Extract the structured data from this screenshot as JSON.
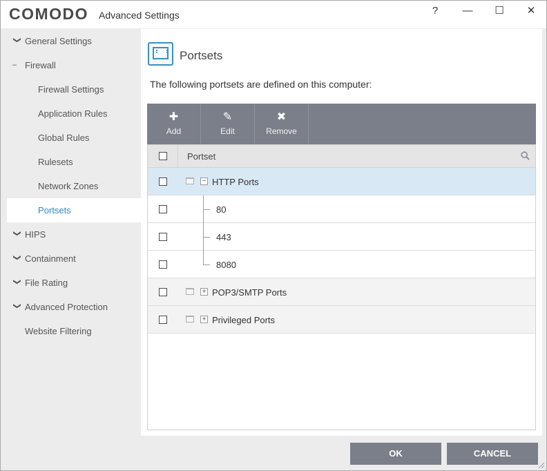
{
  "window": {
    "logo_text": "COMODO",
    "title": "Advanced Settings",
    "help_glyph": "?",
    "minimize_glyph": "—",
    "maximize_glyph": "☐",
    "close_glyph": "✕"
  },
  "sidebar": {
    "items": [
      {
        "label": "General Settings",
        "chevron": "❯"
      },
      {
        "label": "Firewall",
        "chevron": "–"
      },
      {
        "label": "Firewall Settings"
      },
      {
        "label": "Application Rules"
      },
      {
        "label": "Global Rules"
      },
      {
        "label": "Rulesets"
      },
      {
        "label": "Network Zones"
      },
      {
        "label": "Portsets"
      },
      {
        "label": "HIPS",
        "chevron": "❯"
      },
      {
        "label": "Containment",
        "chevron": "❯"
      },
      {
        "label": "File Rating",
        "chevron": "❯"
      },
      {
        "label": "Advanced Protection",
        "chevron": "❯"
      },
      {
        "label": "Website Filtering"
      }
    ]
  },
  "main": {
    "title": "Portsets",
    "description": "The following portsets are defined on this computer:"
  },
  "toolbar": {
    "add_icon": "✚",
    "add_label": "Add",
    "edit_icon": "✎",
    "edit_label": "Edit",
    "remove_icon": "✖",
    "remove_label": "Remove"
  },
  "table": {
    "column_header": "Portset",
    "rows": [
      {
        "label": "HTTP Ports",
        "toggle": "−"
      },
      {
        "label": "80"
      },
      {
        "label": "443"
      },
      {
        "label": "8080"
      },
      {
        "label": "POP3/SMTP Ports",
        "toggle": "+"
      },
      {
        "label": "Privileged Ports",
        "toggle": "+"
      }
    ]
  },
  "footer": {
    "ok_label": "OK",
    "cancel_label": "CANCEL"
  },
  "colors": {
    "accent": "#2e8bc9",
    "toolbar": "#7b7f89",
    "selected_row": "#d9e8f5"
  }
}
